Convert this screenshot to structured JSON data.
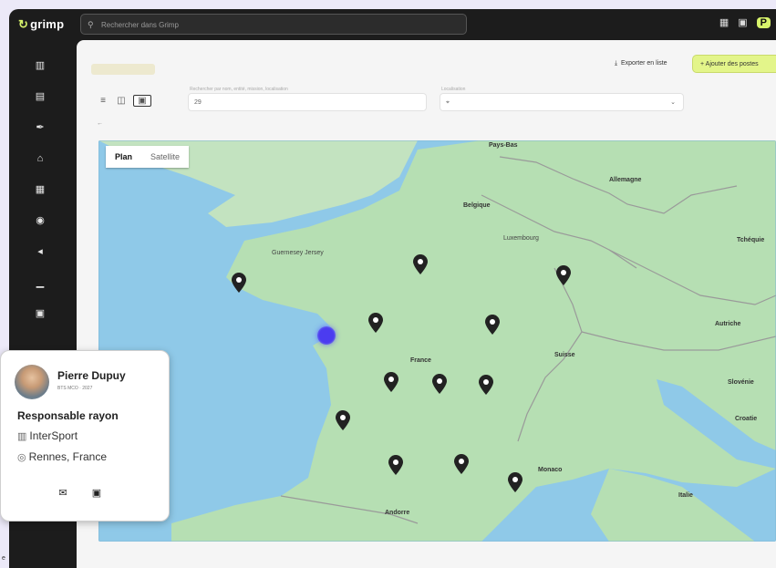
{
  "app": {
    "logo": "grimp",
    "logo_mark": "↻"
  },
  "search": {
    "placeholder": "Rechercher dans Grimp"
  },
  "top_icons": [
    "calendar-icon",
    "notification-icon",
    "profile-badge-icon"
  ],
  "top_badge": "P",
  "sidebar": {
    "items": [
      {
        "icon": "dashboard-icon",
        "glyph": "▥"
      },
      {
        "icon": "document-icon",
        "glyph": "▤"
      },
      {
        "icon": "tools-icon",
        "glyph": "✒"
      },
      {
        "icon": "car-icon",
        "glyph": "⌂"
      },
      {
        "icon": "calendar-icon",
        "glyph": "▦"
      },
      {
        "icon": "globe-icon",
        "glyph": "◉"
      },
      {
        "icon": "megaphone-icon",
        "glyph": "◂"
      },
      {
        "icon": "chart-icon",
        "glyph": "▁"
      },
      {
        "icon": "grid-icon",
        "glyph": "▣"
      }
    ]
  },
  "toolbar": {
    "export_label": "Exporter en liste",
    "export_icon": "⤓",
    "add_label": "+  Ajouter des postes"
  },
  "view_toggle": [
    "≡",
    "◫",
    "▣"
  ],
  "filters": {
    "field1_label": "Rechercher par nom, entité, mission, localisation",
    "field1_value": "29",
    "field2_label": "Localisation",
    "field2_value": "⌖",
    "field2_chevron": "⌄",
    "chip": "←"
  },
  "map": {
    "type_plan": "Plan",
    "type_satellite": "Satellite",
    "labels": {
      "pays_bas": "Pays-Bas",
      "belgique": "Belgique",
      "allemagne": "Allemagne",
      "luxembourg": "Luxembourg",
      "tchequie": "Tchéquie",
      "autriche": "Autriche",
      "suisse": "Suisse",
      "slovenie": "Slovénie",
      "croatie": "Croatie",
      "monaco": "Monaco",
      "italie": "Italie",
      "andorre": "Andorre",
      "france": "France",
      "jersey": "Guernesey Jersey"
    },
    "pin_color": "#222222",
    "position_color": "#4b3cf0"
  },
  "profile_card": {
    "name": "Pierre Dupuy",
    "subtitle": "BTS MCO · 2027",
    "role": "Responsable rayon",
    "company": "InterSport",
    "company_icon": "▥",
    "location": "Rennes, France",
    "location_icon": "◎",
    "actions": [
      "✉",
      "▣"
    ]
  },
  "footer_mark": "e",
  "colors": {
    "accent": "#d7f36b",
    "sidebar": "#1c1c1c",
    "map_water": "#8fc9e8",
    "map_land": "#b6dfb3"
  }
}
